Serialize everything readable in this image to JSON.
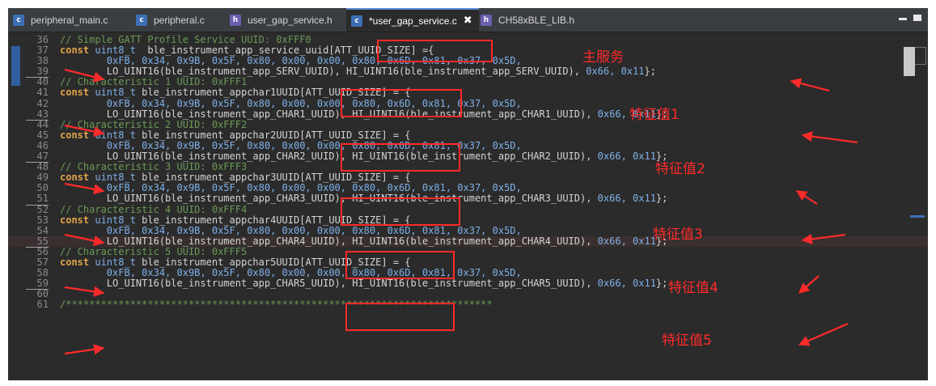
{
  "tabs": [
    {
      "icon": "c",
      "label": "peripheral_main.c"
    },
    {
      "icon": "c",
      "label": "peripheral.c"
    },
    {
      "icon": "h",
      "label": "user_gap_service.h"
    },
    {
      "icon": "c",
      "label": "*user_gap_service.c",
      "close": "✖"
    },
    {
      "icon": "h",
      "label": "CH58xBLE_LIB.h"
    }
  ],
  "lines": [
    {
      "no": "36",
      "parts": [
        {
          "c": "cm",
          "t": "// Simple GATT Profile Service UUID: 0xFFF0"
        }
      ]
    },
    {
      "no": "37",
      "parts": [
        {
          "c": "kw",
          "t": "const "
        },
        {
          "c": "ty",
          "t": "uint8_t"
        },
        {
          "c": "",
          "t": "  ble_instrument_app_service_uuid[ATT_UUID_SIZE] ={"
        }
      ]
    },
    {
      "no": "38",
      "parts": [
        {
          "c": "nm",
          "t": "        0xFB, 0x34, 0x9B, 0x5F, 0x80, 0x00, 0x00, 0x80, 0x6D, 0x81, 0x37, 0x5D,"
        }
      ]
    },
    {
      "no": "39",
      "parts": [
        {
          "c": "",
          "t": "        LO_UINT16(ble_instrument_app_SERV_UUID), HI_UINT16(ble_instrument_app_SERV_UUID), "
        },
        {
          "c": "nm",
          "t": "0x66, 0x11"
        },
        {
          "c": "",
          "t": "};"
        }
      ]
    },
    {
      "no": "40",
      "parts": [
        {
          "c": "cm",
          "t": "// Characteristic 1 UUID: 0xFFF1"
        }
      ]
    },
    {
      "no": "41",
      "parts": [
        {
          "c": "kw",
          "t": "const "
        },
        {
          "c": "ty",
          "t": "uint8_t"
        },
        {
          "c": "",
          "t": " ble_instrument_appchar1UUID[ATT_UUID_SIZE] = {"
        }
      ]
    },
    {
      "no": "42",
      "parts": [
        {
          "c": "nm",
          "t": "        0xFB, 0x34, 0x9B, 0x5F, 0x80, 0x00, 0x00, 0x80, 0x6D, 0x81, 0x37, 0x5D,"
        }
      ]
    },
    {
      "no": "43",
      "parts": [
        {
          "c": "",
          "t": "        LO_UINT16(ble_instrument_app_CHAR1_UUID), HI_UINT16(ble_instrument_app_CHAR1_UUID), "
        },
        {
          "c": "nm",
          "t": "0x66, 0x11"
        },
        {
          "c": "",
          "t": "};"
        }
      ]
    },
    {
      "no": "44",
      "parts": [
        {
          "c": "cm",
          "t": "// Characteristic 2 UUID: 0xFFF2"
        }
      ]
    },
    {
      "no": "45",
      "parts": [
        {
          "c": "kw",
          "t": "const "
        },
        {
          "c": "ty",
          "t": "uint8_t"
        },
        {
          "c": "",
          "t": " ble_instrument_appchar2UUID[ATT_UUID_SIZE] = {"
        }
      ]
    },
    {
      "no": "46",
      "parts": [
        {
          "c": "nm",
          "t": "        0xFB, 0x34, 0x9B, 0x5F, 0x80, 0x00, 0x00, 0x80, 0x6D, 0x81, 0x37, 0x5D,"
        }
      ]
    },
    {
      "no": "47",
      "parts": [
        {
          "c": "",
          "t": "        LO_UINT16(ble_instrument_app_CHAR2_UUID), HI_UINT16(ble_instrument_app_CHAR2_UUID), "
        },
        {
          "c": "nm",
          "t": "0x66, 0x11"
        },
        {
          "c": "",
          "t": "};"
        }
      ]
    },
    {
      "no": "48",
      "parts": [
        {
          "c": "cm",
          "t": "// Characteristic 3 UUID: 0xFFF3"
        }
      ]
    },
    {
      "no": "49",
      "parts": [
        {
          "c": "kw",
          "t": "const "
        },
        {
          "c": "ty",
          "t": "uint8_t"
        },
        {
          "c": "",
          "t": " ble_instrument_appchar3UUID[ATT_UUID_SIZE] = {"
        }
      ]
    },
    {
      "no": "50",
      "parts": [
        {
          "c": "nm",
          "t": "        0xFB, 0x34, 0x9B, 0x5F, 0x80, 0x00, 0x00, 0x80, 0x6D, 0x81, 0x37, 0x5D,"
        }
      ]
    },
    {
      "no": "51",
      "parts": [
        {
          "c": "",
          "t": "        LO_UINT16(ble_instrument_app_CHAR3_UUID), HI_UINT16(ble_instrument_app_CHAR3_UUID), "
        },
        {
          "c": "nm",
          "t": "0x66, 0x11"
        },
        {
          "c": "",
          "t": "};"
        }
      ]
    },
    {
      "no": "52",
      "parts": [
        {
          "c": "cm",
          "t": "// Characteristic 4 UUID: 0xFFF4"
        }
      ]
    },
    {
      "no": "53",
      "parts": [
        {
          "c": "kw",
          "t": "const "
        },
        {
          "c": "ty",
          "t": "uint8_t"
        },
        {
          "c": "",
          "t": " ble_instrument_appchar4UUID[ATT_UUID_SIZE] = {"
        }
      ]
    },
    {
      "no": "54",
      "parts": [
        {
          "c": "nm",
          "t": "        0xFB, 0x34, 0x9B, 0x5F, 0x80, 0x00, 0x00, 0x80, 0x6D, 0x81, 0x37, 0x5D,"
        }
      ]
    },
    {
      "no": "55",
      "parts": [
        {
          "c": "",
          "t": "        LO_UINT16(ble_instrument_app_CHAR4_UUID), HI_UINT16(ble_instrument_app_CHAR4_UUID), "
        },
        {
          "c": "nm",
          "t": "0x66, 0x11"
        },
        {
          "c": "",
          "t": "};"
        }
      ]
    },
    {
      "no": "56",
      "parts": [
        {
          "c": "cm",
          "t": "// Characteristic 5 UUID: 0xFFF5"
        }
      ]
    },
    {
      "no": "57",
      "parts": [
        {
          "c": "kw",
          "t": "const "
        },
        {
          "c": "ty",
          "t": "uint8_t"
        },
        {
          "c": "",
          "t": " ble_instrument_appchar5UUID[ATT_UUID_SIZE] = {"
        }
      ]
    },
    {
      "no": "58",
      "parts": [
        {
          "c": "nm",
          "t": "        0xFB, 0x34, 0x9B, 0x5F, 0x80, 0x00, 0x00, 0x80, 0x6D, 0x81, 0x37, 0x5D,"
        }
      ]
    },
    {
      "no": "59",
      "parts": [
        {
          "c": "",
          "t": "        LO_UINT16(ble_instrument_app_CHAR5_UUID), HI_UINT16(ble_instrument_app_CHAR5_UUID), "
        },
        {
          "c": "nm",
          "t": "0x66, 0x11"
        },
        {
          "c": "",
          "t": "};"
        }
      ]
    },
    {
      "no": "60",
      "parts": [
        {
          "c": "",
          "t": ""
        }
      ]
    },
    {
      "no": "61",
      "parts": [
        {
          "c": "cm",
          "t": "/*************************************************************************"
        }
      ]
    }
  ],
  "annotations": {
    "service": "主服务",
    "char1": "特征值1",
    "char2": "特征值2",
    "char3": "特征值3",
    "char4": "特征值4",
    "char5": "特征值5"
  },
  "colors": {
    "annotation": "#ff2a2a",
    "comment": "#6a9955",
    "keyword": "#e0a34a"
  }
}
